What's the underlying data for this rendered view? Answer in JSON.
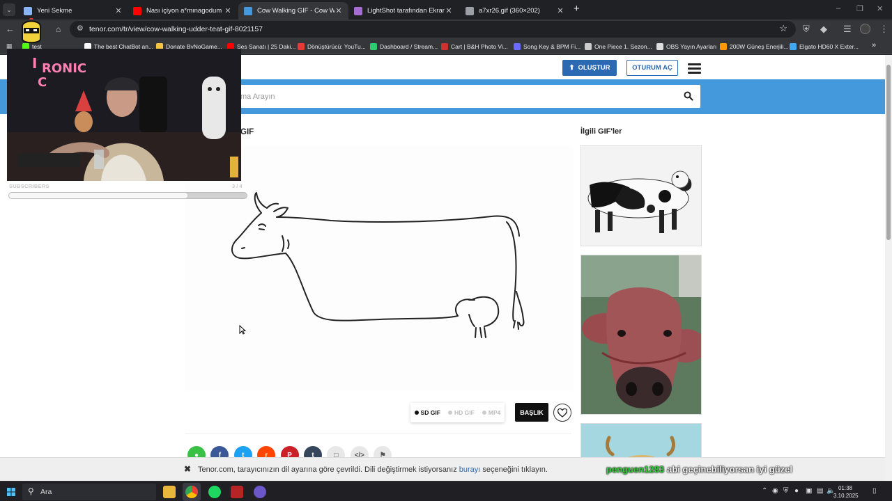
{
  "browser": {
    "tabs": [
      {
        "title": "Yeni Sekme",
        "favicon_color": "#8ab4f8",
        "active": false
      },
      {
        "title": "Nası içiyon a*mınagodum yava...",
        "favicon_color": "#ff0000",
        "active": false
      },
      {
        "title": "Cow Walking GIF - Cow Walkin...",
        "favicon_color": "#4499dd",
        "active": true
      },
      {
        "title": "LightShot tarafından Ekran Gör...",
        "favicon_color": "#a66cd4",
        "active": false
      },
      {
        "title": "a7xr26.gif (360×202)",
        "favicon_color": "#9aa0a6",
        "active": false
      }
    ],
    "new_tab_label": "+",
    "url": "tenor.com/tr/view/cow-walking-udder-teat-gif-8021157",
    "bookmarks": [
      {
        "label": "test",
        "color": "#53fc18"
      },
      {
        "label": "The best ChatBot an...",
        "color": "#ffffff"
      },
      {
        "label": "Donate ByNoGame...",
        "color": "#f5c542"
      },
      {
        "label": "Ses Sanatı | 25 Daki...",
        "color": "#ff0000"
      },
      {
        "label": "Dönüştürücü: YouTu...",
        "color": "#e53935"
      },
      {
        "label": "Dashboard / Stream...",
        "color": "#2ecc71"
      },
      {
        "label": "Cart | B&H Photo Vi...",
        "color": "#d32f2f"
      },
      {
        "label": "Song Key & BPM Fi...",
        "color": "#6b6bff"
      },
      {
        "label": "One Piece 1. Sezon...",
        "color": "#cccccc"
      },
      {
        "label": "OBS Yayın Ayarları",
        "color": "#dddddd"
      },
      {
        "label": "200W Güneş Enerjili...",
        "color": "#ff9900"
      },
      {
        "label": "Elgato HD60 X Exter...",
        "color": "#3fa9f5"
      }
    ]
  },
  "tenor": {
    "create_label": "OLUŞTUR",
    "login_label": "OTURUM AÇ",
    "search_placeholder": "ma Arayın",
    "gif_title": "GIF",
    "related_title": "İlgili GIF'ler",
    "formats": [
      {
        "label": "SD GIF",
        "active": true
      },
      {
        "label": "HD GIF",
        "active": false
      },
      {
        "label": "MP4",
        "active": false
      }
    ],
    "caption_label": "BAŞLIK",
    "share_icons": [
      {
        "name": "sms-share-icon",
        "glyph": "●",
        "color": "#3ac047"
      },
      {
        "name": "facebook-share-icon",
        "glyph": "f",
        "color": "#3b5998"
      },
      {
        "name": "twitter-share-icon",
        "glyph": "t",
        "color": "#1da1f2"
      },
      {
        "name": "reddit-share-icon",
        "glyph": "r",
        "color": "#ff4500"
      },
      {
        "name": "pinterest-share-icon",
        "glyph": "P",
        "color": "#cb2027"
      },
      {
        "name": "tumblr-share-icon",
        "glyph": "t",
        "color": "#35465c"
      },
      {
        "name": "instagram-share-icon",
        "glyph": "□",
        "color": "#e8e8e8"
      },
      {
        "name": "embed-share-icon",
        "glyph": "</>",
        "color": "#e8e8e8"
      },
      {
        "name": "flag-icon",
        "glyph": "⚑",
        "color": "#e8e8e8"
      }
    ],
    "language_notice": {
      "before": "Tenor.com, tarayıcınızın dil ayarına göre çevrildi. Dili değiştirmek istiyorsanız ",
      "link": "burayı",
      "after": " seçeneğini tıklayın."
    }
  },
  "overlay": {
    "logo_text": "IRONIC",
    "sub_label": "SUBSCRIBERS",
    "sub_count": "3 / 4",
    "sub_progress": 0.75,
    "chat_user": "penguen1283",
    "chat_message": "abi geçinebiliyorsan iyi güzel"
  },
  "taskbar": {
    "search_placeholder": "Ara",
    "time": "01:38",
    "date": "3.10.2025"
  }
}
